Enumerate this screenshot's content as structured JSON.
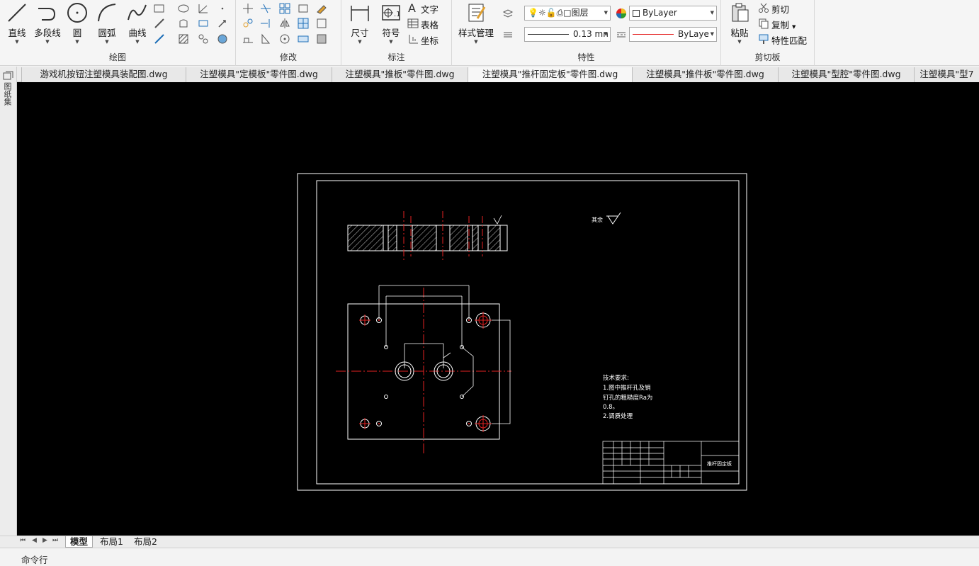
{
  "ribbon": {
    "draw": {
      "title": "绘图",
      "line": "直线",
      "polyline": "多段线",
      "circle": "圆",
      "arc": "圆弧",
      "curve": "曲线"
    },
    "modify": {
      "title": "修改"
    },
    "annotate": {
      "title": "标注",
      "dimension": "尺寸",
      "symbol": "符号",
      "text": "文字",
      "table": "表格",
      "coordinate": "坐标"
    },
    "properties": {
      "title": "特性",
      "style_manager": "样式管理",
      "layer": "图层",
      "color": "ByLayer",
      "lineweight": "0.13 mn",
      "linetype": "ByLaye"
    },
    "clipboard": {
      "title": "剪切板",
      "paste": "粘贴",
      "cut": "剪切",
      "copy": "复制",
      "match": "特性匹配"
    }
  },
  "doc_tabs": [
    "游戏机按钮注塑模具装配图.dwg",
    "注塑模具\"定模板\"零件图.dwg",
    "注塑模具\"推板\"零件图.dwg",
    "注塑模具\"推杆固定板\"零件图.dwg",
    "注塑模具\"推件板\"零件图.dwg",
    "注塑模具\"型腔\"零件图.dwg",
    "注塑模具\"型7"
  ],
  "sidebar": {
    "label": "图纸集"
  },
  "drawing": {
    "tech_title": "技术要求:",
    "tech_lines": [
      "1.图中推杆孔及销",
      "钉孔的粗糙度Ra为",
      "0.8。",
      "2.调质处理"
    ],
    "part_name": "推杆固定板",
    "roughness_note": "其余"
  },
  "layout_tabs": {
    "model": "模型",
    "layout1": "布局1",
    "layout2": "布局2"
  },
  "command": {
    "label": "命令行"
  },
  "colors": {
    "accent_red": "#e52222",
    "paper": "#000000",
    "line": "#ffffff"
  }
}
